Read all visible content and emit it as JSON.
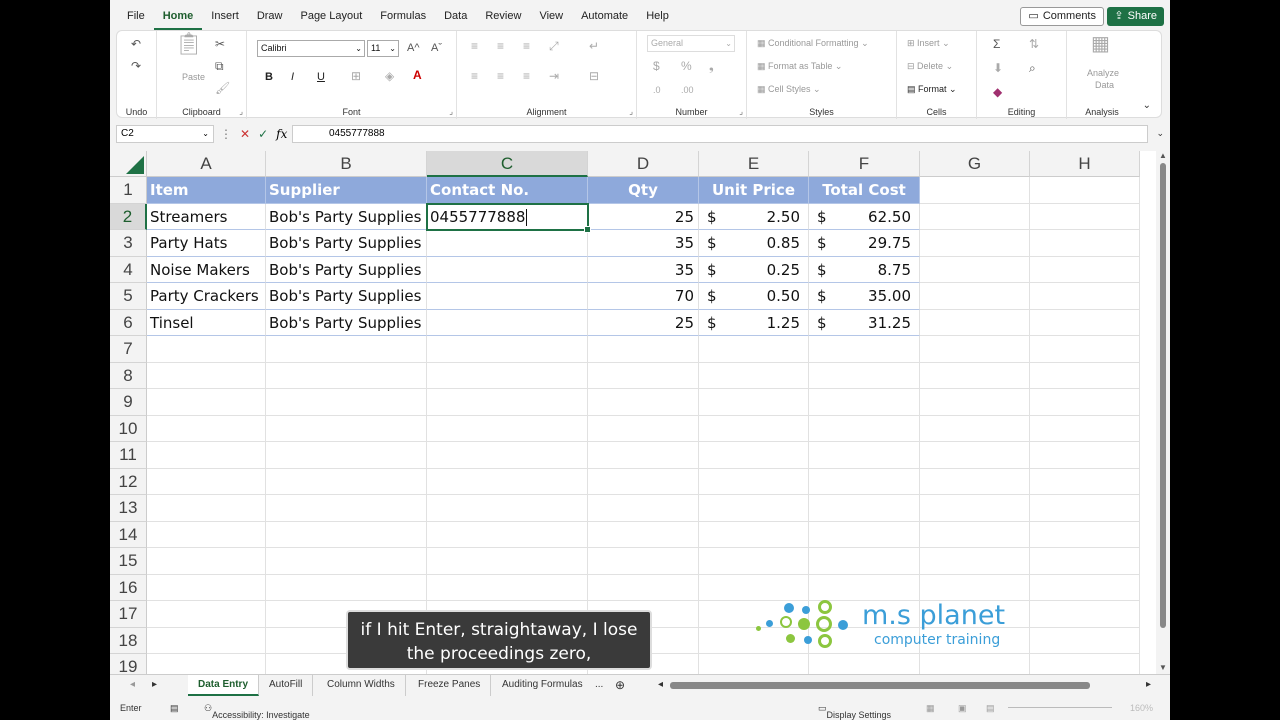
{
  "menu": [
    "File",
    "Home",
    "Insert",
    "Draw",
    "Page Layout",
    "Formulas",
    "Data",
    "Review",
    "View",
    "Automate",
    "Help"
  ],
  "menu_active": "Home",
  "buttons": {
    "comments": "Comments",
    "share": "Share"
  },
  "ribbon": {
    "groups": {
      "undo": "Undo",
      "clipboard": "Clipboard",
      "font": "Font",
      "alignment": "Alignment",
      "number": "Number",
      "styles": "Styles",
      "cells": "Cells",
      "editing": "Editing",
      "analysis": "Analysis"
    },
    "paste_label": "Paste",
    "font_name": "Calibri",
    "font_size": "11",
    "number_format": "General",
    "conditional_formatting": "Conditional Formatting",
    "format_as_table": "Format as Table",
    "cell_styles": "Cell Styles",
    "insert": "Insert",
    "delete": "Delete",
    "format": "Format",
    "analyze_data_line1": "Analyze",
    "analyze_data_line2": "Data",
    "bold": "B",
    "italic": "I",
    "underline": "U"
  },
  "formula_bar": {
    "name_box": "C2",
    "fx": "fx",
    "value": "0455777888"
  },
  "columns": [
    "A",
    "B",
    "C",
    "D",
    "E",
    "F",
    "G",
    "H"
  ],
  "selected_column": "C",
  "rows": [
    "1",
    "2",
    "3",
    "4",
    "5",
    "6",
    "7",
    "8",
    "9",
    "10",
    "11",
    "12",
    "13",
    "14",
    "15",
    "16",
    "17",
    "18",
    "19"
  ],
  "selected_row": "2",
  "table": {
    "headers": [
      "Item",
      "Supplier",
      "Contact No.",
      "Qty",
      "Unit Price",
      "Total Cost"
    ],
    "currency_symbol": "$",
    "records": [
      {
        "item": "Streamers",
        "supplier": "Bob's Party Supplies",
        "contact": "0455777888",
        "qty": "25",
        "unit_price": "2.50",
        "total": "62.50"
      },
      {
        "item": "Party Hats",
        "supplier": "Bob's Party Supplies",
        "contact": "",
        "qty": "35",
        "unit_price": "0.85",
        "total": "29.75"
      },
      {
        "item": "Noise Makers",
        "supplier": "Bob's Party Supplies",
        "contact": "",
        "qty": "35",
        "unit_price": "0.25",
        "total": "8.75"
      },
      {
        "item": "Party Crackers",
        "supplier": "Bob's Party Supplies",
        "contact": "",
        "qty": "70",
        "unit_price": "0.50",
        "total": "35.00"
      },
      {
        "item": "Tinsel",
        "supplier": "Bob's Party Supplies",
        "contact": "",
        "qty": "25",
        "unit_price": "1.25",
        "total": "31.25"
      }
    ]
  },
  "caption": {
    "line1": "if I hit Enter, straightaway, I lose",
    "line2": "the proceedings zero,"
  },
  "logo": {
    "brand": "m.s planet",
    "tagline": "computer training"
  },
  "sheet_tabs": [
    "Data Entry",
    "AutoFill",
    "Column Widths",
    "Freeze Panes",
    "Auditing Formulas",
    "..."
  ],
  "active_sheet": "Data Entry",
  "status": {
    "mode": "Enter",
    "accessibility": "Accessibility: Investigate",
    "display_settings": "Display Settings",
    "zoom": "160%"
  },
  "colors": {
    "excel_green": "#1e7145",
    "table_header": "#8ea9db",
    "logo_blue": "#3b9ed8",
    "logo_green": "#8cc63f"
  }
}
